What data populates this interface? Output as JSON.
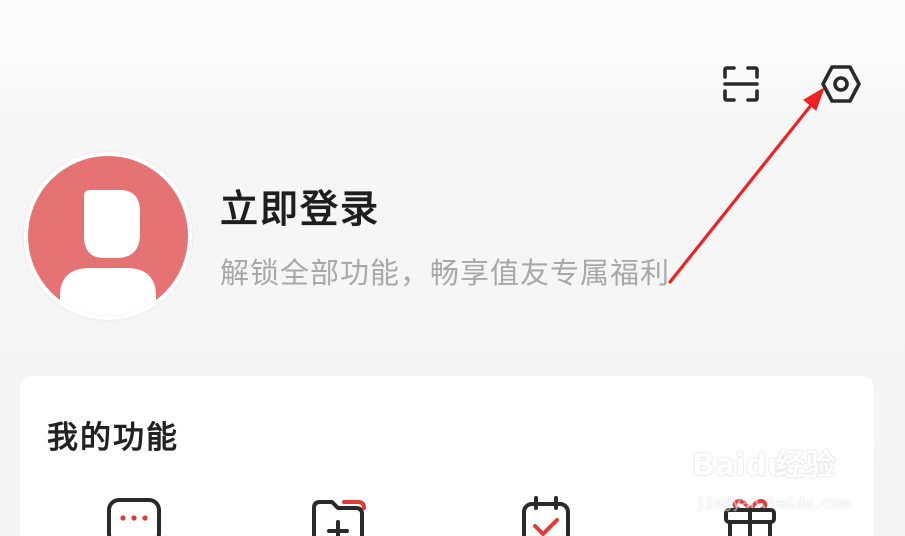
{
  "header": {
    "scan_icon": "scan-icon",
    "settings_icon": "settings-hexagon-icon"
  },
  "profile": {
    "avatar_icon": "default-avatar-icon",
    "avatar_color": "#e57373",
    "title": "立即登录",
    "subtitle": "解锁全部功能，畅享值友专属福利"
  },
  "annotation": {
    "arrow_color": "#ee2222"
  },
  "functions": {
    "title": "我的功能",
    "icons": [
      "message-dots-icon",
      "folder-add-icon",
      "clipboard-check-icon",
      "gift-icon"
    ]
  },
  "watermark": {
    "logo_text": "Bai",
    "logo_suffix": "经验",
    "url": "jingyan.baidu.com"
  }
}
